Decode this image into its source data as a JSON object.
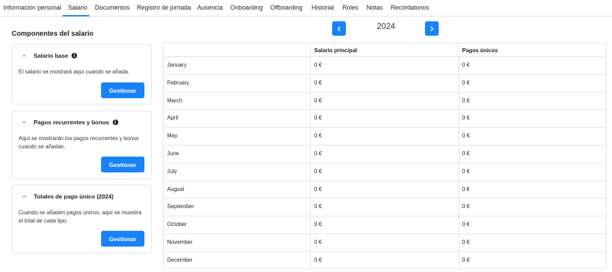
{
  "tabs": [
    {
      "label": "Información personal"
    },
    {
      "label": "Salario"
    },
    {
      "label": "Documentos"
    },
    {
      "label": "Registro de jornada"
    },
    {
      "label": "Ausencia"
    },
    {
      "label": "Onboarding"
    },
    {
      "label": "Offboarding"
    },
    {
      "label": "Historial"
    },
    {
      "label": "Roles"
    },
    {
      "label": "Notas"
    },
    {
      "label": "Recordatorios"
    }
  ],
  "active_tab": "Salario",
  "section_title": "Componentes del salario",
  "year": "2024",
  "cards": [
    {
      "title": "Salario base",
      "has_info": true,
      "description": "El salario se mostrará aquí cuando se añada.",
      "button": "Gestionar"
    },
    {
      "title": "Pagos recurrentes y bonus",
      "has_info": true,
      "description": "Aquí se mostrarán los pagos recurrentes y bonus cuando se añadan.",
      "button": "Gestionar"
    },
    {
      "title": "Totales de pago único (2024)",
      "has_info": false,
      "description": "Cuando se añaden pagos únicos, aquí se muestra el total de cada tipo.",
      "button": "Gestionar"
    }
  ],
  "table": {
    "headers": [
      "",
      "Salario principal",
      "Pagos únicos"
    ],
    "rows": [
      {
        "month": "January",
        "salary": "0 €",
        "one_off": "0 €"
      },
      {
        "month": "February",
        "salary": "0 €",
        "one_off": "0 €"
      },
      {
        "month": "March",
        "salary": "0 €",
        "one_off": "0 €"
      },
      {
        "month": "April",
        "salary": "0 €",
        "one_off": "0 €"
      },
      {
        "month": "May",
        "salary": "0 €",
        "one_off": "0 €"
      },
      {
        "month": "June",
        "salary": "0 €",
        "one_off": "0 €"
      },
      {
        "month": "July",
        "salary": "0 €",
        "one_off": "0 €"
      },
      {
        "month": "August",
        "salary": "0 €",
        "one_off": "0 €"
      },
      {
        "month": "September",
        "salary": "0 €",
        "one_off": "0 €"
      },
      {
        "month": "October",
        "salary": "0 €",
        "one_off": "0 €"
      },
      {
        "month": "November",
        "salary": "0 €",
        "one_off": "0 €"
      },
      {
        "month": "December",
        "salary": "0 €",
        "one_off": "0 €"
      }
    ]
  },
  "icons": {
    "prev": "chevron-left-icon",
    "next": "chevron-right-icon",
    "collapse": "chevron-up-icon",
    "info": "info-icon"
  },
  "colors": {
    "accent": "#1a82f7",
    "border": "#e3e3e6",
    "text": "#1d1d1f"
  }
}
